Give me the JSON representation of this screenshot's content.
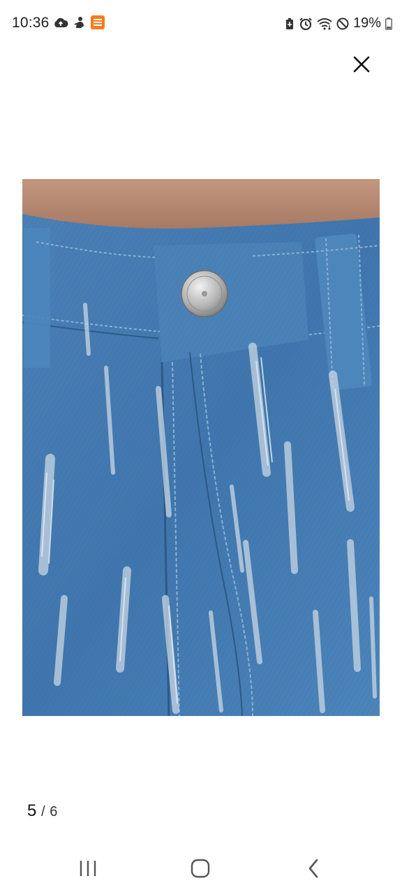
{
  "status_bar": {
    "time": "10:36",
    "battery_percent": "19%",
    "left_icons": [
      "cloud-upload-icon",
      "app-notification-icon",
      "temu-app-icon"
    ],
    "right_icons": [
      "battery-saver-icon",
      "alarm-icon",
      "wifi-icon",
      "do-not-disturb-icon",
      "battery-icon"
    ],
    "temu_badge_color": "#f57c1f"
  },
  "viewer": {
    "close_icon": "close-icon",
    "image_description": "jeans",
    "pagination": {
      "current": "5",
      "separator": "/",
      "total": "6"
    }
  },
  "nav_bar": {
    "buttons": [
      "recent-apps-icon",
      "home-icon",
      "back-icon"
    ]
  },
  "colors": {
    "background": "#ffffff",
    "denim": "#4a7fb5",
    "skin": "#b98a74"
  }
}
